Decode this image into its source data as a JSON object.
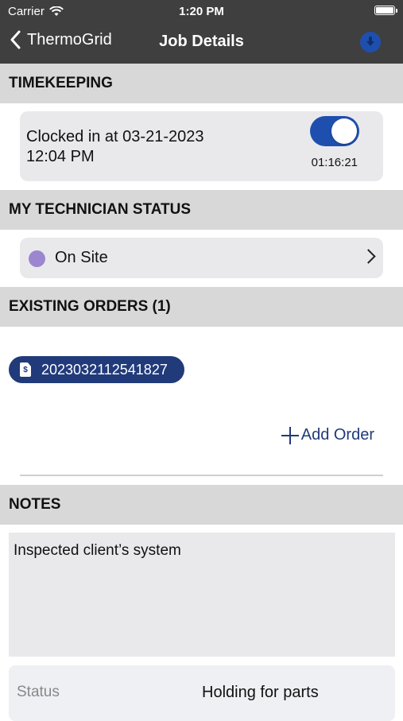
{
  "status_bar": {
    "carrier": "Carrier",
    "time": "1:20 PM"
  },
  "nav": {
    "back_label": "ThermoGrid",
    "title": "Job Details"
  },
  "timekeeping": {
    "header": "TIMEKEEPING",
    "clock_line1": "Clocked in at 03-21-2023",
    "clock_line2": "12:04 PM",
    "toggle_on": true,
    "elapsed": "01:16:21"
  },
  "technician_status": {
    "header": "MY TECHNICIAN STATUS",
    "status": "On Site",
    "dot_color": "#9b86cf"
  },
  "orders": {
    "header": "EXISTING ORDERS (1)",
    "items": [
      "202303211254182​7"
    ],
    "add_label": "Add Order"
  },
  "notes": {
    "header": "NOTES",
    "text": "Inspected client’s system"
  },
  "status_row": {
    "label": "Status",
    "value": "Holding for parts"
  },
  "colors": {
    "accent": "#213a7a",
    "toggle": "#1f4fae",
    "bar": "#3f3f3f"
  }
}
